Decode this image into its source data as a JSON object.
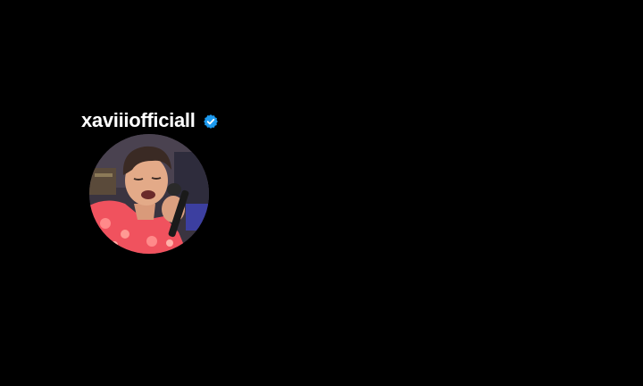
{
  "profile": {
    "username": "xaviiiofficiall",
    "verified": true,
    "verified_icon": "verified-badge-icon",
    "avatar_icon": "profile-avatar",
    "colors": {
      "background": "#000000",
      "username": "#ffffff",
      "verified_badge": "#1d9bf0"
    }
  }
}
